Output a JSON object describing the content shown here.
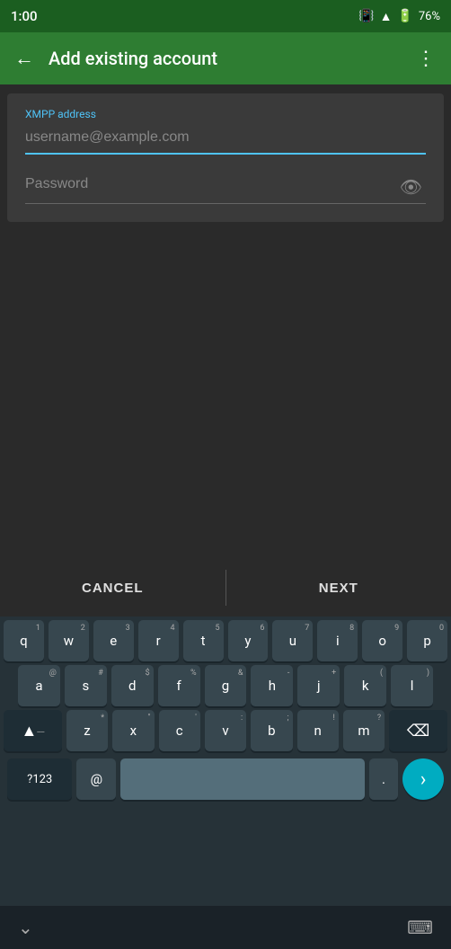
{
  "statusBar": {
    "time": "1:00",
    "battery": "76%"
  },
  "appBar": {
    "title": "Add existing account",
    "backLabel": "←",
    "menuLabel": "⋮"
  },
  "form": {
    "xmppLabel": "XMPP address",
    "xmppPlaceholder": "username@example.com",
    "passwordLabel": "Password"
  },
  "actions": {
    "cancelLabel": "CANCEL",
    "nextLabel": "NEXT"
  },
  "keyboard": {
    "rows": [
      {
        "keys": [
          {
            "label": "q",
            "super": "1"
          },
          {
            "label": "w",
            "super": "2"
          },
          {
            "label": "e",
            "super": "3"
          },
          {
            "label": "r",
            "super": "4"
          },
          {
            "label": "t",
            "super": "5"
          },
          {
            "label": "y",
            "super": "6"
          },
          {
            "label": "u",
            "super": "7"
          },
          {
            "label": "i",
            "super": "8"
          },
          {
            "label": "o",
            "super": "9"
          },
          {
            "label": "p",
            "super": "0"
          }
        ]
      },
      {
        "keys": [
          {
            "label": "a",
            "super": "@"
          },
          {
            "label": "s",
            "super": "#"
          },
          {
            "label": "d",
            "super": "$"
          },
          {
            "label": "f",
            "super": "%"
          },
          {
            "label": "g",
            "super": "&"
          },
          {
            "label": "h",
            "super": "-"
          },
          {
            "label": "j",
            "super": "+"
          },
          {
            "label": "k",
            "super": "("
          },
          {
            "label": "l",
            "super": ")"
          }
        ]
      },
      {
        "keys": [
          {
            "label": "z",
            "super": "*"
          },
          {
            "label": "x",
            "super": "\""
          },
          {
            "label": "c",
            "super": "'"
          },
          {
            "label": "v",
            "super": ":"
          },
          {
            "label": "b",
            "super": ";"
          },
          {
            "label": "n",
            "super": "!"
          },
          {
            "label": "m",
            "super": "?"
          }
        ]
      }
    ],
    "bottomRow": {
      "symbolsLabel": "?123",
      "atLabel": "@",
      "periodLabel": ".",
      "goIcon": "›"
    },
    "navRow": {
      "downIcon": "⌄",
      "keyboardIcon": "⌨"
    }
  }
}
